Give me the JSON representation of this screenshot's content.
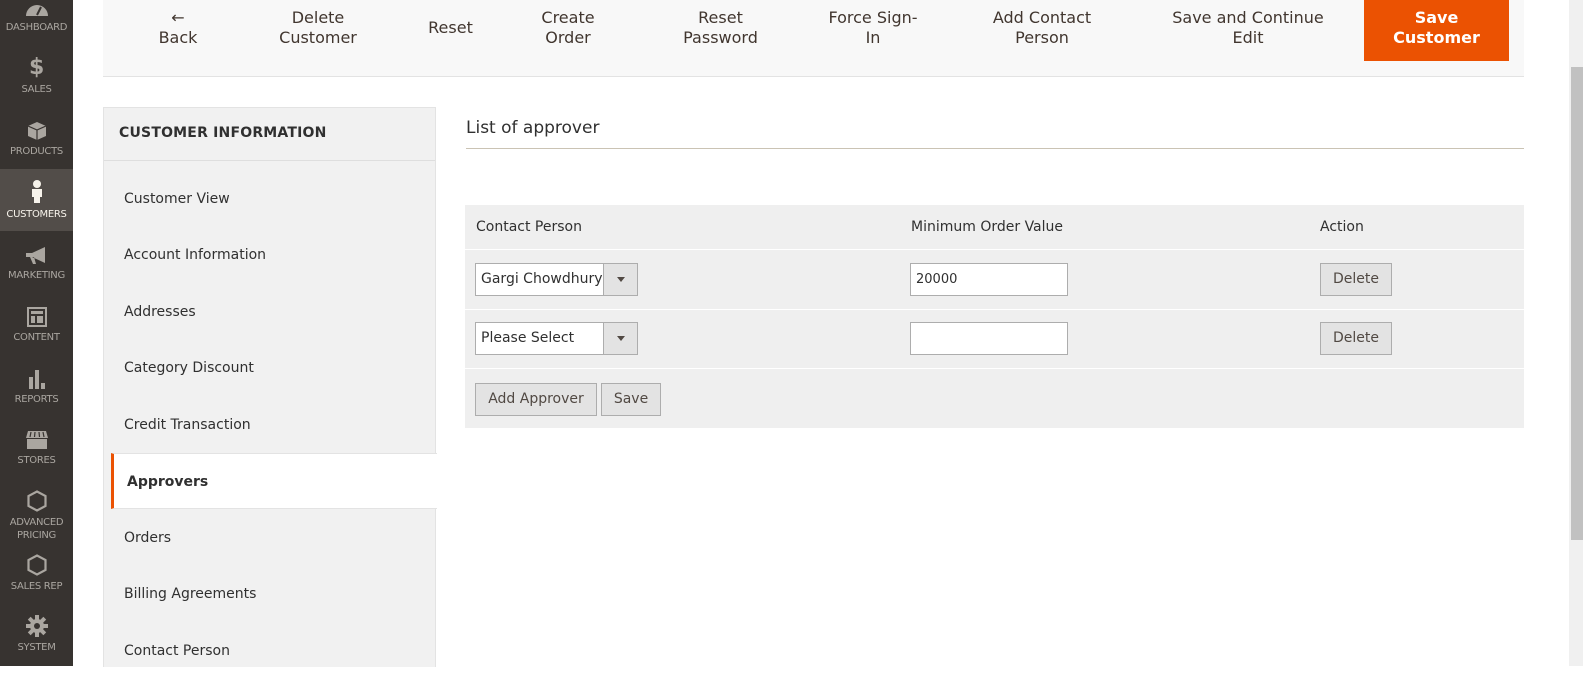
{
  "nav": {
    "items": [
      {
        "label": "DASHBOARD",
        "icon": "dashboard-icon"
      },
      {
        "label": "SALES",
        "icon": "dollar-icon"
      },
      {
        "label": "PRODUCTS",
        "icon": "box-icon"
      },
      {
        "label": "CUSTOMERS",
        "icon": "person-icon",
        "active": true
      },
      {
        "label": "MARKETING",
        "icon": "megaphone-icon"
      },
      {
        "label": "CONTENT",
        "icon": "layout-icon"
      },
      {
        "label": "REPORTS",
        "icon": "bar-chart-icon"
      },
      {
        "label": "STORES",
        "icon": "storefront-icon"
      },
      {
        "label": "ADVANCED PRICING",
        "label_l1": "ADVANCED",
        "label_l2": "PRICING",
        "icon": "hexagon-icon"
      },
      {
        "label": "SALES REP",
        "icon": "hexagon-icon"
      },
      {
        "label": "SYSTEM",
        "icon": "gear-icon"
      }
    ]
  },
  "actions": {
    "back": {
      "icon": "arrow-left-icon",
      "label": "Back"
    },
    "delete_customer": {
      "l1": "Delete",
      "l2": "Customer"
    },
    "reset": "Reset",
    "create_order": {
      "l1": "Create",
      "l2": "Order"
    },
    "reset_password": {
      "l1": "Reset",
      "l2": "Password"
    },
    "force_signin": {
      "l1": "Force Sign-",
      "l2": "In"
    },
    "add_contact": {
      "l1": "Add Contact",
      "l2": "Person"
    },
    "save_continue": {
      "l1": "Save and Continue",
      "l2": "Edit"
    },
    "save_customer": {
      "l1": "Save",
      "l2": "Customer"
    },
    "primary_color": "#eb5202"
  },
  "tabs": {
    "title": "CUSTOMER INFORMATION",
    "items": [
      {
        "label": "Customer View"
      },
      {
        "label": "Account Information"
      },
      {
        "label": "Addresses"
      },
      {
        "label": "Category Discount"
      },
      {
        "label": "Credit Transaction"
      },
      {
        "label": "Approvers",
        "active": true
      },
      {
        "label": "Orders"
      },
      {
        "label": "Billing Agreements"
      },
      {
        "label": "Contact Person"
      }
    ]
  },
  "main": {
    "title": "List of approver",
    "columns": [
      "Contact Person",
      "Minimum Order Value",
      "Action"
    ],
    "rows": [
      {
        "contact": "Gargi Chowdhury",
        "min_value": "20000",
        "action": "Delete"
      },
      {
        "contact": "Please Select",
        "min_value": "",
        "action": "Delete"
      }
    ],
    "add_button": "Add Approver",
    "save_button": "Save"
  }
}
